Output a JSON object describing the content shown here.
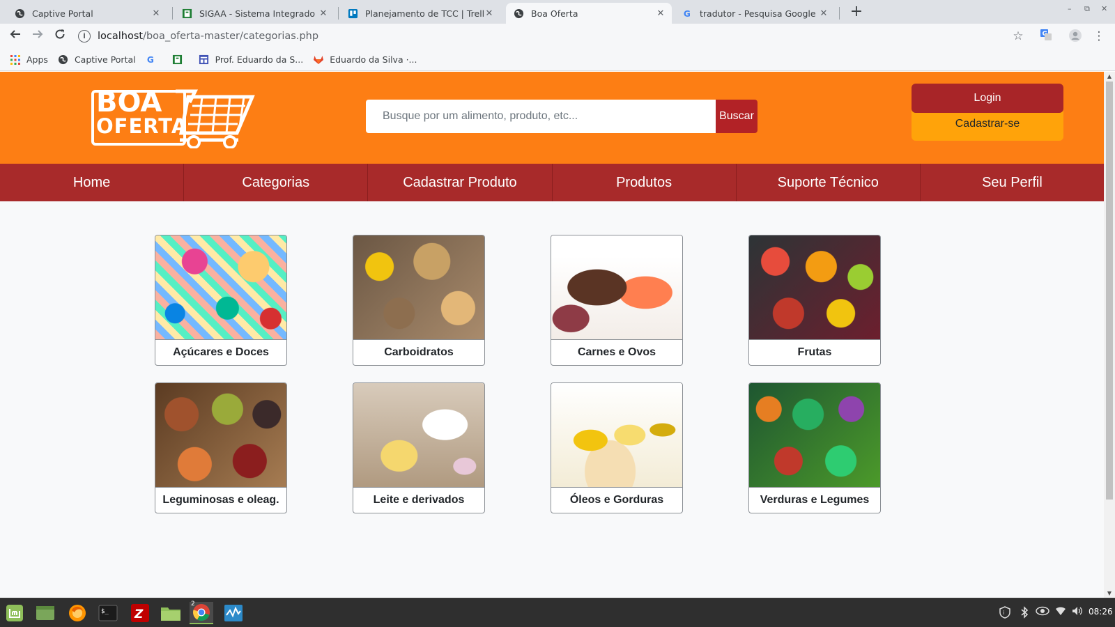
{
  "browser": {
    "tabs": [
      {
        "title": "Captive Portal",
        "icon": "globe-icon",
        "active": false
      },
      {
        "title": "SIGAA - Sistema Integrado de Gestão",
        "icon": "sigaa-icon",
        "active": false
      },
      {
        "title": "Planejamento de TCC | Trello",
        "icon": "trello-icon",
        "active": false
      },
      {
        "title": "Boa Oferta",
        "icon": "globe-icon",
        "active": true
      },
      {
        "title": "tradutor - Pesquisa Google",
        "icon": "google-icon",
        "active": false
      }
    ],
    "address": {
      "host": "localhost",
      "path": "/boa_oferta-master/categorias.php"
    },
    "bookmarks": [
      {
        "label": "Apps",
        "icon": "apps-grid-icon"
      },
      {
        "label": "Captive Portal",
        "icon": "globe-icon"
      },
      {
        "label": "",
        "icon": "google-icon"
      },
      {
        "label": "",
        "icon": "sigaa-icon"
      },
      {
        "label": "Prof. Eduardo da S...",
        "icon": "doc-icon"
      },
      {
        "label": "Eduardo da Silva ·...",
        "icon": "gitlab-icon"
      }
    ]
  },
  "site": {
    "logo": {
      "line1": "BOA",
      "line2": "OFERTA"
    },
    "search": {
      "placeholder": "Busque por um alimento, produto, etc...",
      "button": "Buscar"
    },
    "auth": {
      "login": "Login",
      "signup": "Cadastrar-se"
    },
    "nav": [
      "Home",
      "Categorias",
      "Cadastrar Produto",
      "Produtos",
      "Suporte Técnico",
      "Seu Perfil"
    ],
    "categories": [
      {
        "label": "Açúcares e Doces",
        "texture": "doces"
      },
      {
        "label": "Carboidratos",
        "texture": "carbo"
      },
      {
        "label": "Carnes e Ovos",
        "texture": "carnes"
      },
      {
        "label": "Frutas",
        "texture": "frutas"
      },
      {
        "label": "Leguminosas e oleag.",
        "texture": "legum"
      },
      {
        "label": "Leite e derivados",
        "texture": "leite"
      },
      {
        "label": "Óleos e Gorduras",
        "texture": "oleos"
      },
      {
        "label": "Verduras e Legumes",
        "texture": "verduras"
      }
    ]
  },
  "taskbar": {
    "clock": "08:26",
    "chrome_window_count": "2"
  },
  "colors": {
    "header_orange": "#fd7e14",
    "nav_red": "#a82a2a",
    "button_red": "#b22226",
    "signup_bg": "#ffa30a"
  }
}
